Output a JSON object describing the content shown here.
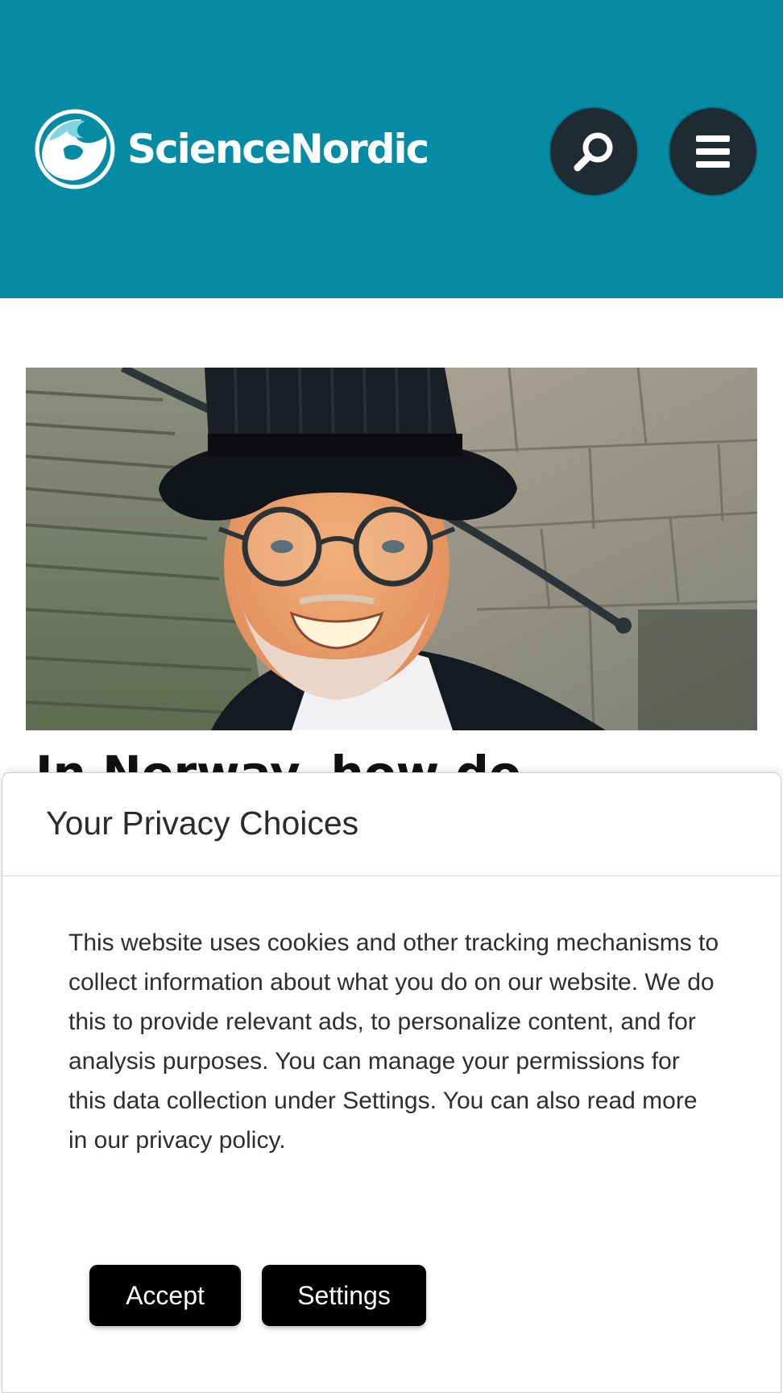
{
  "header": {
    "brand_name": "ScienceNordic",
    "logo_icon": "sciencenordic-wave-logo",
    "search_icon": "search-icon",
    "menu_icon": "hamburger-menu-icon",
    "colors": {
      "header_background": "#068ba4",
      "button_background": "#1f2b33"
    }
  },
  "article": {
    "hero_image_subject": "smiling man in black top hat and round glasses in front of stone stairs",
    "headline_partial": "In Norway, how do"
  },
  "privacy_dialog": {
    "title": "Your Privacy Choices",
    "body": "This website uses cookies and other tracking mechanisms to collect information about what you do on our website. We do this to provide relevant ads, to personalize content, and for analysis purposes. You can manage your permissions for this data collection under Settings. You can also read more in our privacy policy.",
    "accept_label": "Accept",
    "settings_label": "Settings"
  }
}
